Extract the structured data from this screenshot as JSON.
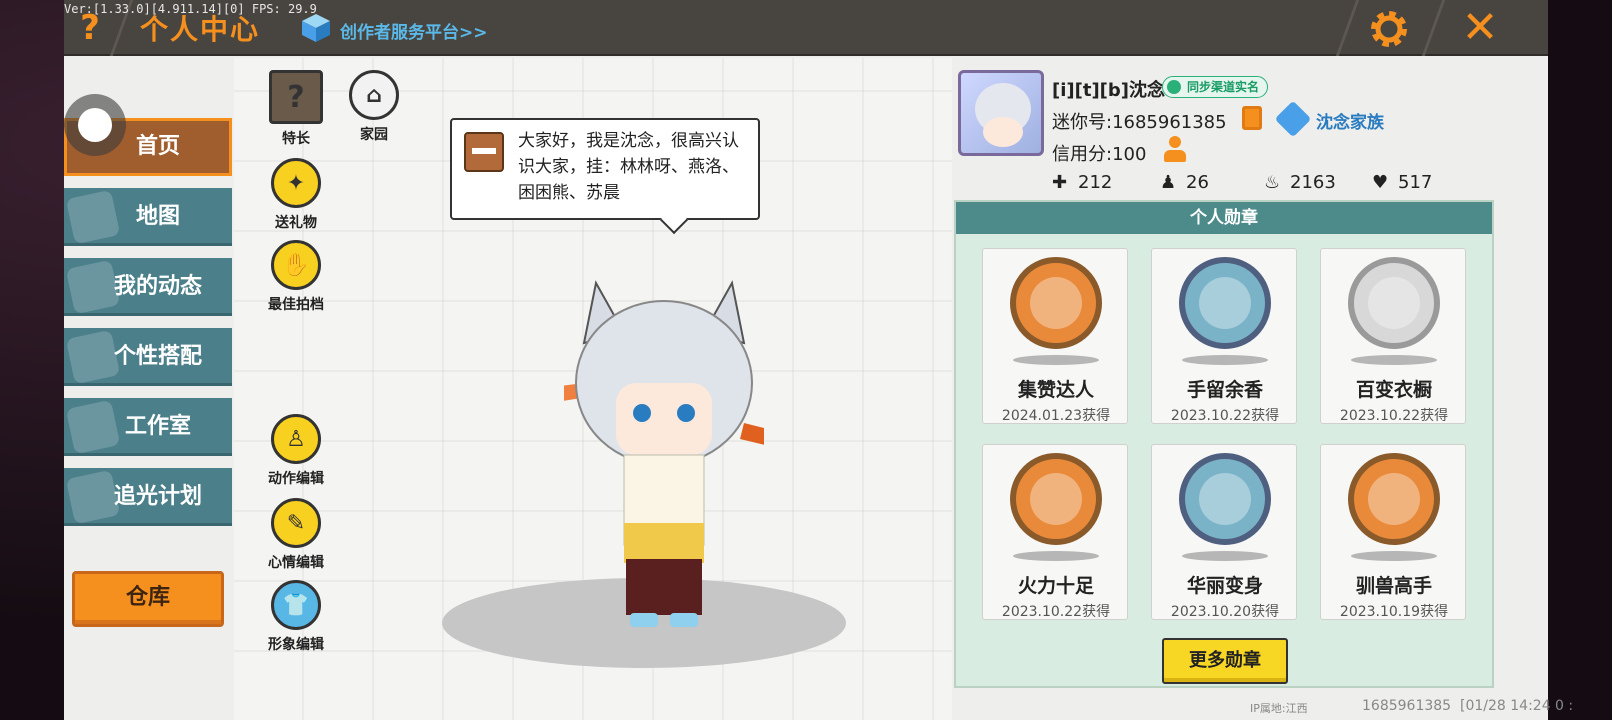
{
  "debug": {
    "version_text": "Ver:[1.33.0][4.911.14][0] FPS: 29.9"
  },
  "header": {
    "help_icon": "question-mark-icon",
    "title": "个人中心",
    "creator_link": "创作者服务平台>>",
    "accent_color": "#f5901e"
  },
  "sidebar": {
    "items": [
      {
        "label": "首页",
        "active": true
      },
      {
        "label": "地图"
      },
      {
        "label": "我的动态"
      },
      {
        "label": "个性搭配"
      },
      {
        "label": "工作室"
      },
      {
        "label": "追光计划"
      }
    ],
    "warehouse_label": "仓库"
  },
  "actions": {
    "specialty": "特长",
    "home": "家园",
    "gift": "送礼物",
    "partner": "最佳拍档",
    "action_edit": "动作编辑",
    "mood_edit": "心情编辑",
    "look_edit": "形象编辑"
  },
  "bubble": {
    "text": "大家好，我是沈念，很高兴认识大家，挂：林林呀、燕洛、困困熊、苏晨"
  },
  "profile": {
    "nickname": "[i][t][b]沈念",
    "realname_badge": "同步渠道实名",
    "mini_id": "迷你号:1685961385",
    "family": "沈念家族",
    "credit": "信用分:100",
    "stats": {
      "likes": "212",
      "fans": "26",
      "heat": "2163",
      "hearts": "517"
    }
  },
  "medals": {
    "title": "个人勋章",
    "items": [
      {
        "name": "集赞达人",
        "date": "2024.01.23获得"
      },
      {
        "name": "手留余香",
        "date": "2023.10.22获得"
      },
      {
        "name": "百变衣橱",
        "date": "2023.10.22获得"
      },
      {
        "name": "火力十足",
        "date": "2023.10.22获得"
      },
      {
        "name": "华丽变身",
        "date": "2023.10.20获得"
      },
      {
        "name": "驯兽高手",
        "date": "2023.10.19获得"
      }
    ],
    "more_label": "更多勋章"
  },
  "footer": {
    "ip": "IP属地:江西",
    "uid": "1685961385",
    "time": "[01/28 14:24 0 :"
  }
}
